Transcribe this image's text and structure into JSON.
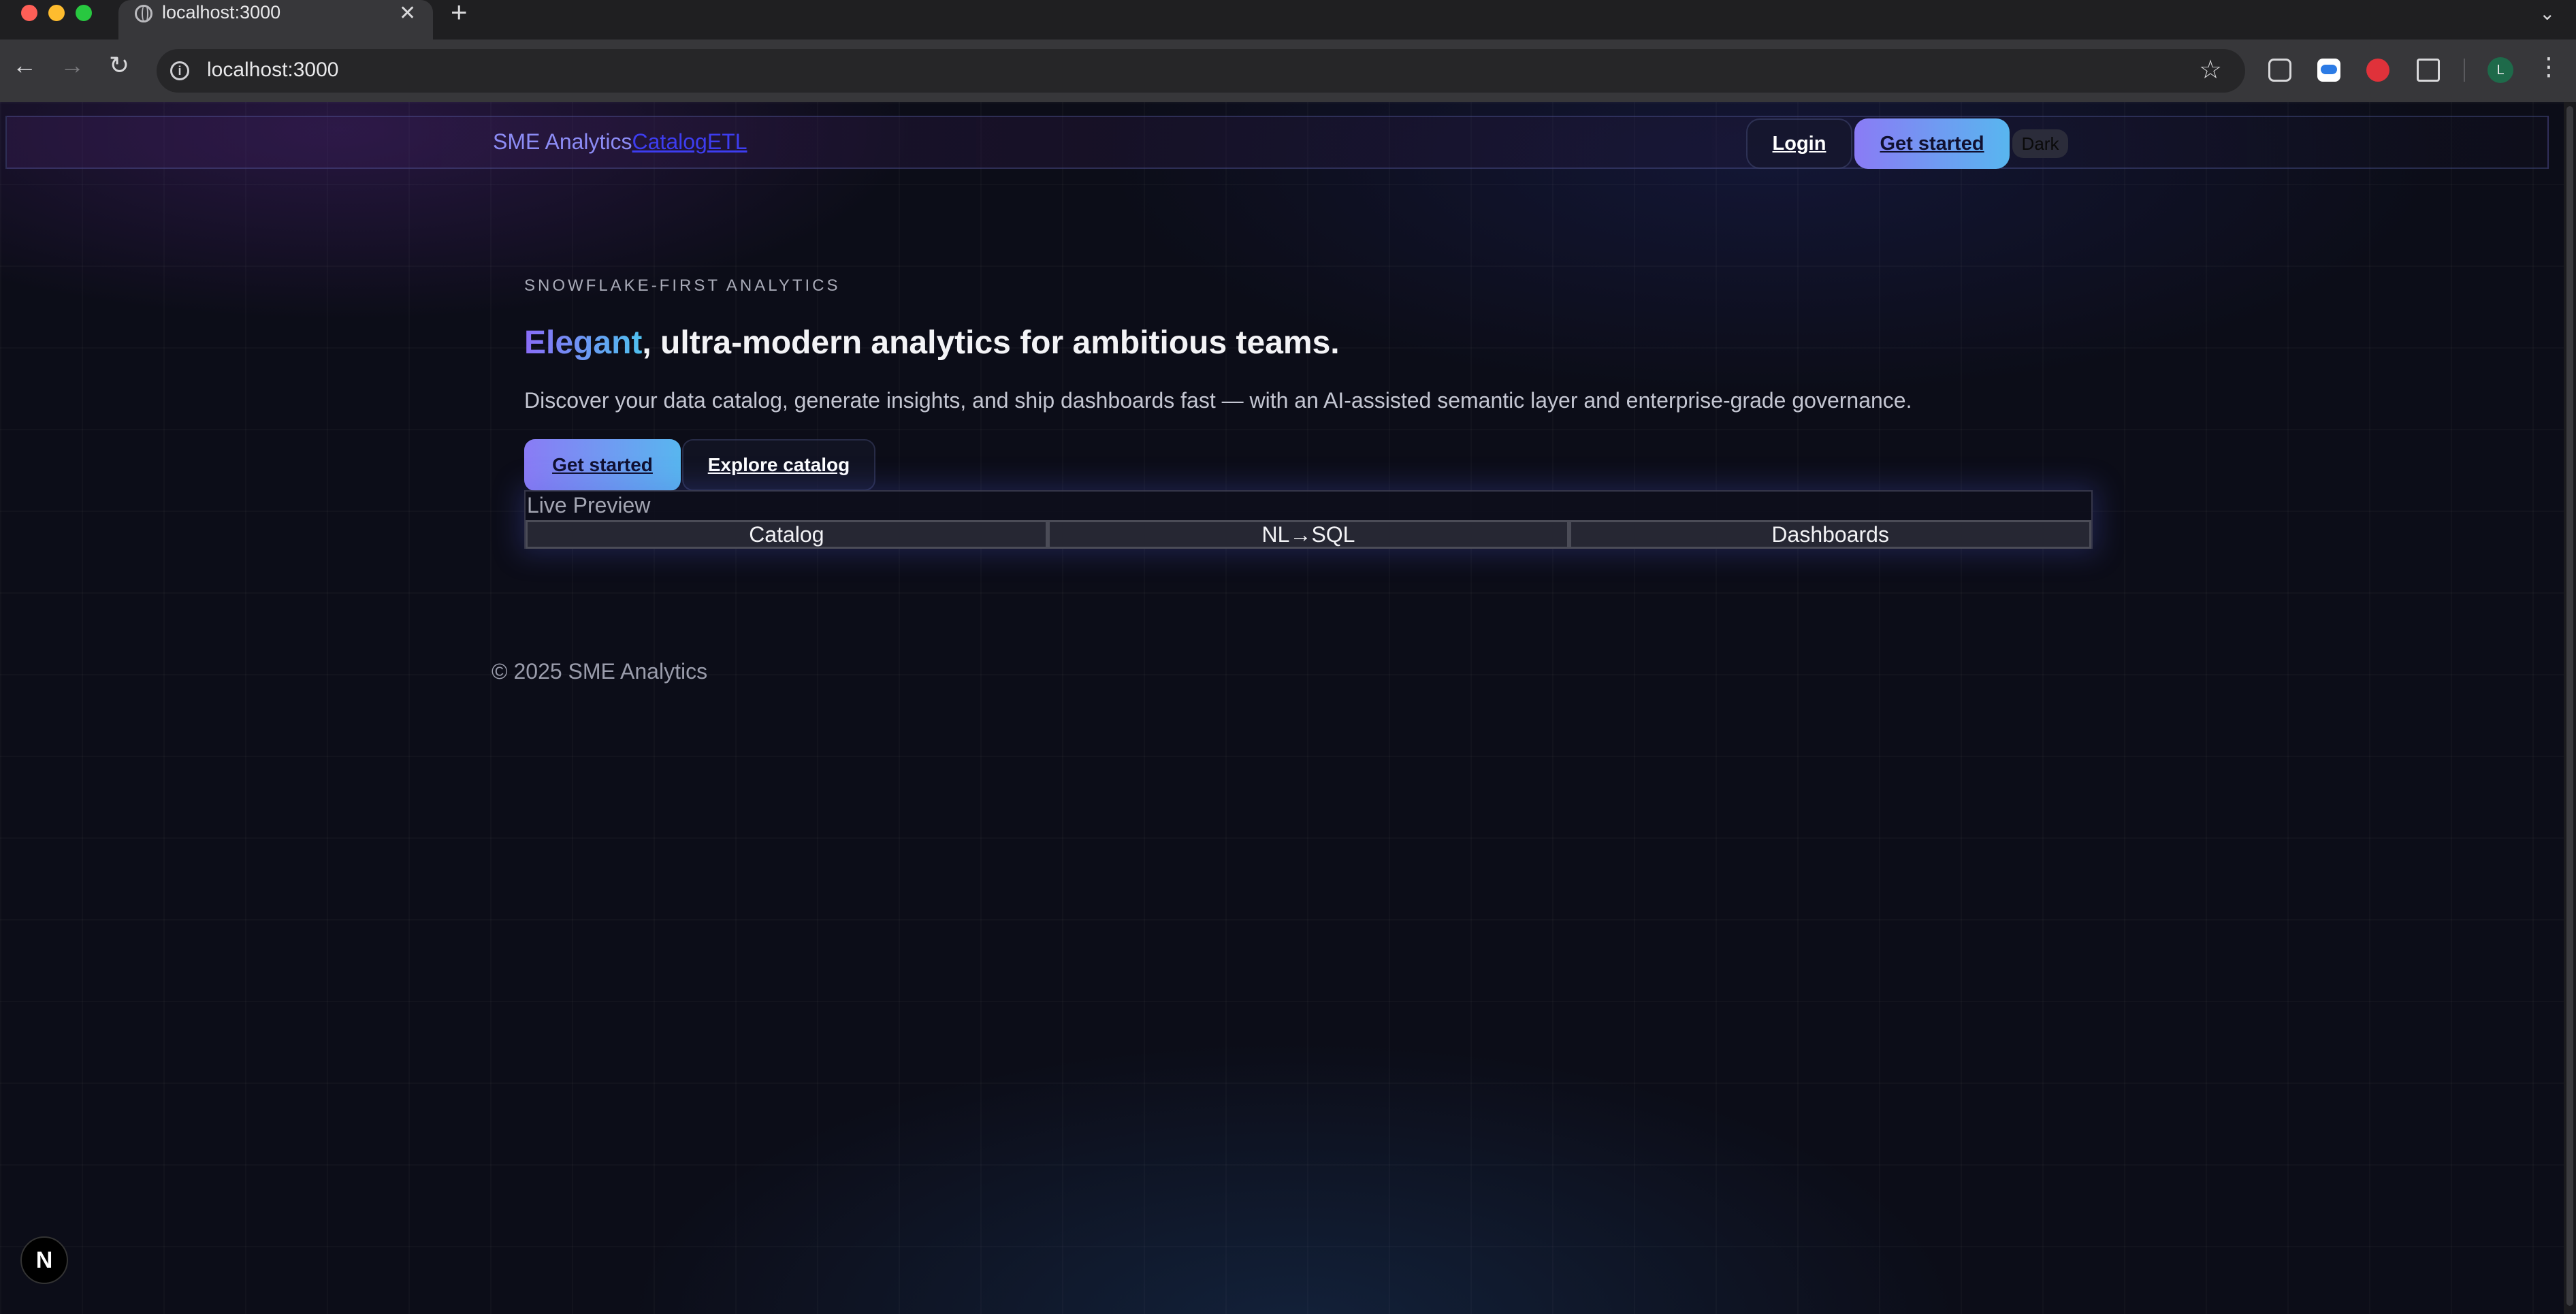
{
  "browser": {
    "tab_title": "localhost:3000",
    "tab_close": "✕",
    "new_tab": "+",
    "url": "localhost:3000",
    "info_icon": "i",
    "star_icon": "☆",
    "profile_initial": "L",
    "back": "←",
    "forward": "→",
    "reload": "↻",
    "menu": "⋮",
    "tab_list": "⌄"
  },
  "header": {
    "brand": "SME Analytics",
    "nav": [
      "Catalog",
      "ETL"
    ],
    "login": "Login",
    "get_started": "Get started",
    "theme_toggle": "Dark"
  },
  "hero": {
    "eyebrow": "SNOWFLAKE-FIRST ANALYTICS",
    "headline_accent": "Elegant",
    "headline_rest": ", ultra-modern analytics for ambitious teams.",
    "subtext": "Discover your data catalog, generate insights, and ship dashboards fast — with an AI-assisted semantic layer and enterprise-grade governance.",
    "cta_primary": "Get started",
    "cta_secondary": "Explore catalog"
  },
  "preview": {
    "title": "Live Preview",
    "tabs": [
      "Catalog",
      "NL→SQL",
      "Dashboards"
    ]
  },
  "footer": {
    "copyright": "© 2025 SME Analytics"
  },
  "dev_badge": "N",
  "colors": {
    "accent_start": "#8a7bf5",
    "accent_end": "#58b6ef",
    "background": "#0c0d18"
  }
}
